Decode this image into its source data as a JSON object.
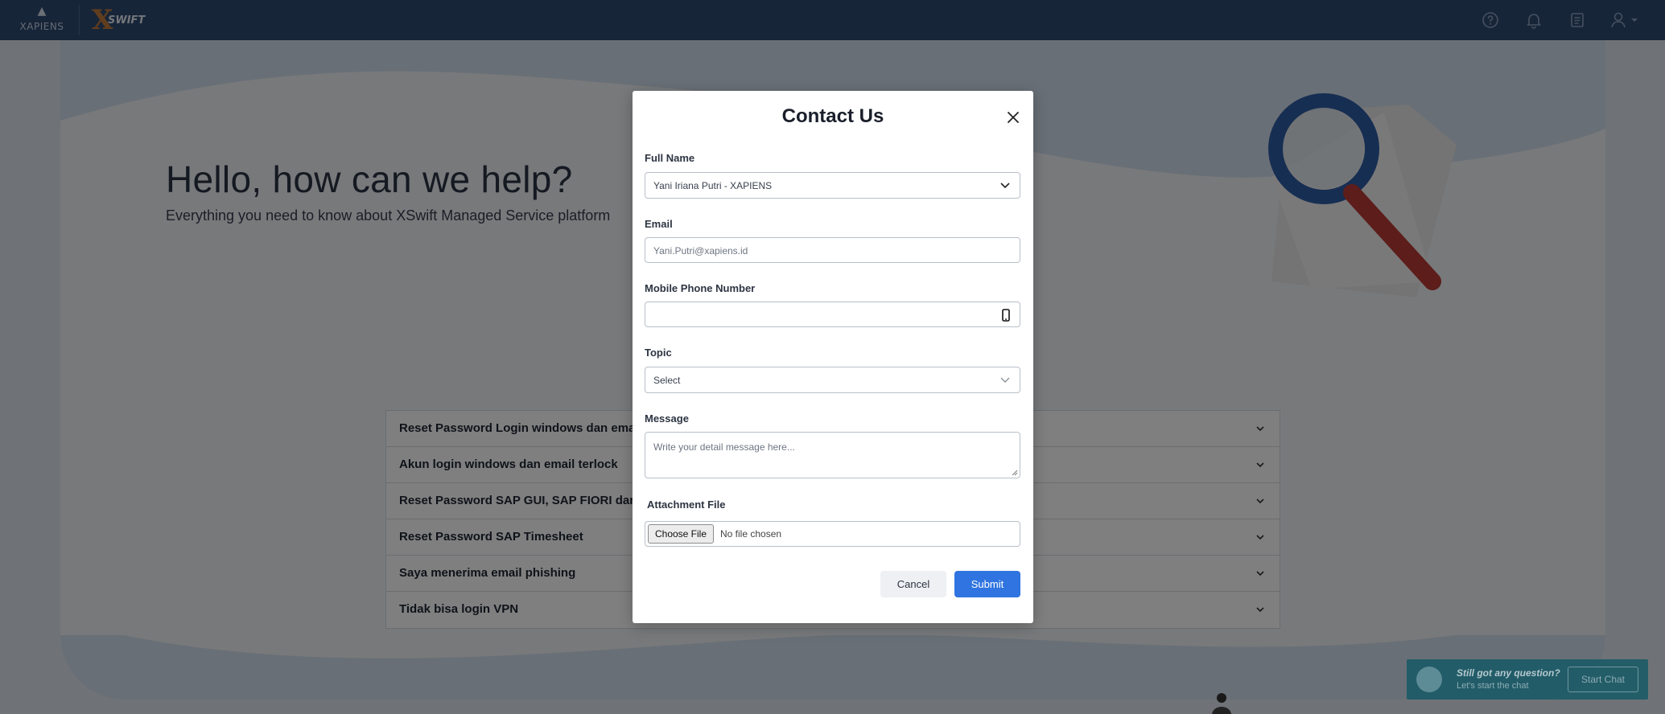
{
  "topbar": {
    "brand_xapiens": "XAPIENS",
    "brand_swift": "SWIFT",
    "icons": [
      "help-icon",
      "bell-icon",
      "document-icon",
      "user-icon"
    ]
  },
  "hero": {
    "title": "Hello, how can we help?",
    "subtitle": "Everything you need to know about XSwift Managed Service platform"
  },
  "faq": {
    "items": [
      "Reset Password Login windows dan email",
      "Akun login windows dan email terlock",
      "Reset Password SAP GUI, SAP FIORI dan SAP",
      "Reset Password SAP Timesheet",
      "Saya menerima email phishing",
      "Tidak bisa login VPN"
    ]
  },
  "chat": {
    "question": "Still got any question?",
    "sub": "Let's start the chat",
    "button": "Start Chat"
  },
  "modal": {
    "title": "Contact Us",
    "full_name": {
      "label": "Full Name",
      "value": "Yani Iriana Putri - XAPIENS"
    },
    "email": {
      "label": "Email",
      "value": "Yani.Putri@xapiens.id"
    },
    "phone": {
      "label": "Mobile Phone Number",
      "value": ""
    },
    "topic": {
      "label": "Topic",
      "value": "Select"
    },
    "message": {
      "label": "Message",
      "placeholder": "Write your detail message here..."
    },
    "attachment": {
      "label": "Attachment File",
      "button": "Choose File",
      "status": "No file chosen"
    },
    "cancel": "Cancel",
    "submit": "Submit"
  },
  "colors": {
    "topbar": "#2e4a72",
    "primary": "#2f74e0",
    "chat": "#1f5c68"
  }
}
